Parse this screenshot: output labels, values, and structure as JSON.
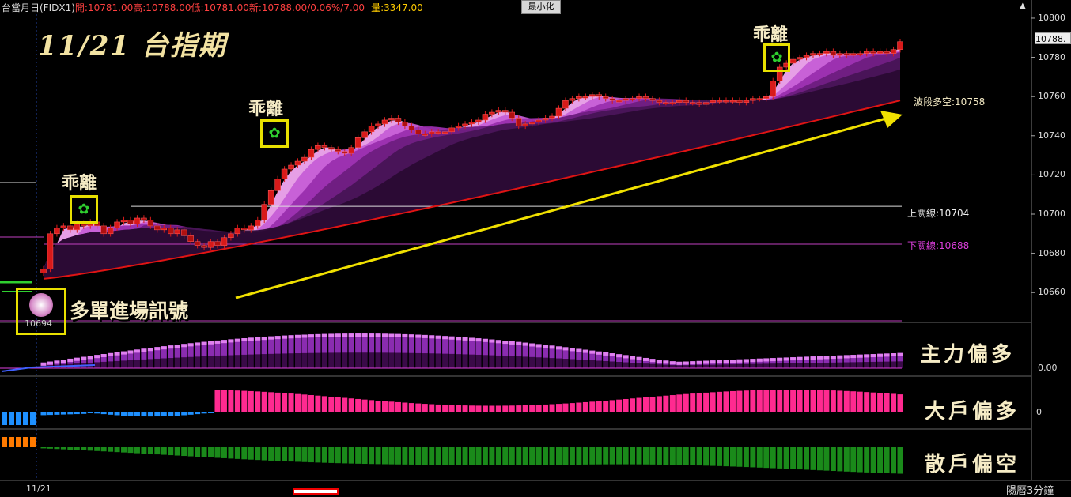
{
  "header": {
    "instrument": "台當月日(FIDX1)",
    "open": "開:10781.00",
    "high": "高:10788.00",
    "low": "低:10781.00",
    "new": "新:10788.00/0.06%/7.00",
    "volume": "量:3347.00",
    "minimize_label": "最小化"
  },
  "title": "11/21 台指期",
  "signals": {
    "divergence_label": "乖離",
    "entry_label": "多單進場訊號",
    "entry_price": "10694"
  },
  "levels": {
    "upper": "上關線:10704",
    "lower": "下關線:10688",
    "wave": "波段多空:10758"
  },
  "indicators": {
    "main_force": "主力偏多",
    "main_force_value": "0.00",
    "big_player": "大戶偏多",
    "big_player_value": "0",
    "retail": "散戶偏空"
  },
  "price_axis": {
    "ticks": [
      "10800",
      "10780",
      "10760",
      "10740",
      "10720",
      "10700",
      "10680",
      "10660"
    ],
    "current_price": "10788."
  },
  "footer": {
    "date_label": "11/21",
    "period_label": "陽曆3分鐘"
  },
  "colors": {
    "up_candle": "#d81a1a",
    "down_candle": "#d81a1a",
    "ribbon_light": "#f0a0f0",
    "ribbon_dark": "#2a0a30",
    "wave_line": "#e01414",
    "trend_arrow": "#f0e000",
    "main_force_bars": "#b040e0",
    "big_player_bars": "#ff2a90",
    "big_player_neg": "#1e90ff",
    "retail_bars": "#1a8a1a",
    "retail_pos": "#ff7a00"
  },
  "chart_data": {
    "type": "candlestick",
    "ylim": [
      10648,
      10802
    ],
    "closes": [
      10672,
      10690,
      10693,
      10694,
      10692,
      10695,
      10694,
      10696,
      10694,
      10690,
      10693,
      10696,
      10697,
      10695,
      10698,
      10697,
      10694,
      10692,
      10693,
      10690,
      10692,
      10689,
      10686,
      10684,
      10683,
      10686,
      10684,
      10688,
      10690,
      10693,
      10692,
      10694,
      10697,
      10705,
      10712,
      10718,
      10723,
      10725,
      10727,
      10729,
      10733,
      10735,
      10734,
      10733,
      10732,
      10731,
      10734,
      10739,
      10742,
      10745,
      10746,
      10748,
      10749,
      10747,
      10745,
      10743,
      10741,
      10741,
      10742,
      10742,
      10742,
      10744,
      10745,
      10746,
      10747,
      10748,
      10751,
      10752,
      10753,
      10752,
      10749,
      10745,
      10746,
      10747,
      10748,
      10749,
      10750,
      10754,
      10758,
      10759,
      10760,
      10760,
      10761,
      10760,
      10759,
      10758,
      10758,
      10759,
      10759,
      10760,
      10759,
      10758,
      10757,
      10757,
      10757,
      10758,
      10757,
      10757,
      10756,
      10757,
      10758,
      10758,
      10758,
      10758,
      10757,
      10758,
      10759,
      10759,
      10760,
      10768,
      10775,
      10777,
      10779,
      10780,
      10781,
      10782,
      10782,
      10783,
      10781,
      10782,
      10781,
      10782,
      10782,
      10783,
      10782,
      10783,
      10782,
      10784,
      10788
    ],
    "wave_line": {
      "start": 10667,
      "end": 10758
    },
    "upper_line": 10704,
    "lower_line": 10688,
    "main_force_range": [
      0,
      1
    ],
    "big_player_range": [
      -1,
      1
    ],
    "retail_range": [
      -1,
      1
    ]
  }
}
